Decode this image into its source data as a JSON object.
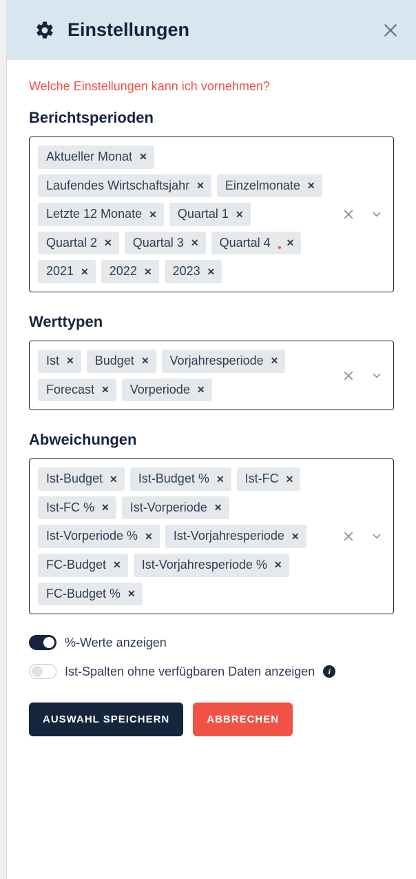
{
  "header": {
    "title": "Einstellungen"
  },
  "help_link": "Welche Einstellungen kann ich vornehmen?",
  "sections": {
    "berichtsperioden": {
      "title": "Berichtsperioden",
      "chips": [
        "Aktueller Monat",
        "Laufendes Wirtschaftsjahr",
        "Einzelmonate",
        "Letzte 12 Monate",
        "Quartal 1",
        "Quartal 2",
        "Quartal 3",
        "Quartal 4",
        "2021",
        "2022",
        "2023"
      ]
    },
    "werttypen": {
      "title": "Werttypen",
      "chips": [
        "Ist",
        "Budget",
        "Vorjahresperiode",
        "Forecast",
        "Vorperiode"
      ]
    },
    "abweichungen": {
      "title": "Abweichungen",
      "chips": [
        "Ist-Budget",
        "Ist-Budget %",
        "Ist-FC",
        "Ist-FC %",
        "Ist-Vorperiode",
        "Ist-Vorperiode %",
        "Ist-Vorjahresperiode",
        "FC-Budget",
        "Ist-Vorjahresperiode %",
        "FC-Budget %"
      ]
    }
  },
  "toggles": {
    "percent": {
      "label": "%-Werte anzeigen",
      "on": true
    },
    "ist_cols": {
      "label": "Ist-Spalten ohne verfügbaren Daten anzeigen",
      "on": false
    }
  },
  "buttons": {
    "save": "Auswahl speichern",
    "cancel": "Abbrechen"
  }
}
